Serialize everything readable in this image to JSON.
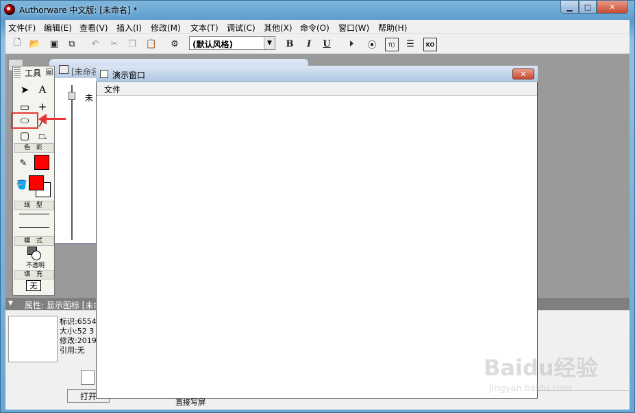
{
  "window": {
    "title": "Authorware 中文版: [未命名] *",
    "controls": {
      "minimize": "▁",
      "maximize": "□",
      "close": "✕"
    }
  },
  "menu": [
    "文件(F)",
    "编辑(E)",
    "查看(V)",
    "插入(I)",
    "修改(M)",
    "文本(T)",
    "调试(C)",
    "其他(X)",
    "命令(O)",
    "窗口(W)",
    "帮助(H)"
  ],
  "toolbar": {
    "style_combo": "(默认风格)",
    "bold": "B",
    "italic": "I",
    "underline": "U",
    "fn": "f()",
    "ko": "KO"
  },
  "design_window": {
    "title": "[未命名",
    "flow_label": "未"
  },
  "tools": {
    "title": "工具",
    "close": "⊠",
    "color_header": "色 彩",
    "line_header": "线 型",
    "mode_header": "模 式",
    "mode_label": "不透明",
    "fill_header": "填 充",
    "fill_value": "无",
    "pen_color": "#ff0000",
    "fill_color": "#ff0000"
  },
  "annotation": {
    "highlight_color": "#e53535"
  },
  "presentation_window": {
    "title": "演示窗口",
    "menu_file": "文件",
    "close": "✕"
  },
  "properties": {
    "header": "属性: 显示图标 [未命",
    "lines": [
      "标识:6554",
      "大小:52 3",
      "修改:2019",
      "引用:无"
    ],
    "open_button": "打开",
    "lower_text": "直接写屏"
  },
  "watermark": {
    "main": "Baidu经验",
    "sub": "jingyan.baidu.com"
  }
}
